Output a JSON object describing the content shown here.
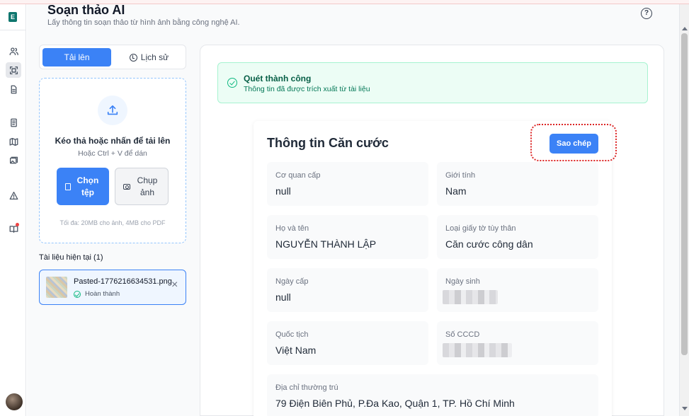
{
  "header": {
    "title": "Soạn thảo AI",
    "subtitle": "Lấy thông tin soạn thảo từ hình ảnh bằng công nghệ AI."
  },
  "sidebar_icons": [
    "users-icon",
    "scan-icon",
    "document-icon",
    "file-text-icon",
    "map-icon",
    "images-icon",
    "warning-icon",
    "book-icon"
  ],
  "tabs": [
    {
      "label": "Tải lên",
      "active": true
    },
    {
      "label": "Lịch sử",
      "active": false
    }
  ],
  "upload": {
    "title": "Kéo thả hoặc nhấn để tải lên",
    "hint": "Hoặc Ctrl + V để dán",
    "choose_label": "Chọn tệp",
    "capture_label": "Chụp ảnh",
    "limit": "Tối đa: 20MB cho ảnh, 4MB cho PDF"
  },
  "current_docs": {
    "label": "Tài liệu hiện tại (1)",
    "files": [
      {
        "name": "Pasted-1776216634531.png",
        "status": "Hoàn thành"
      }
    ]
  },
  "alert": {
    "title": "Quét thành công",
    "message": "Thông tin đã được trích xuất từ tài liệu"
  },
  "result": {
    "title": "Thông tin Căn cước",
    "copy_label": "Sao chép",
    "fields": {
      "issuer": {
        "label": "Cơ quan cấp",
        "value": "null"
      },
      "gender": {
        "label": "Giới tính",
        "value": "Nam"
      },
      "fullname": {
        "label": "Họ và tên",
        "value": "NGUYỄN THÀNH LẬP"
      },
      "doc_type": {
        "label": "Loại giấy tờ tùy thân",
        "value": "Căn cước công dân"
      },
      "issue_date": {
        "label": "Ngày cấp",
        "value": "null"
      },
      "dob": {
        "label": "Ngày sinh",
        "value": ""
      },
      "nationality": {
        "label": "Quốc tịch",
        "value": "Việt Nam"
      },
      "id_number": {
        "label": "Số CCCD",
        "value": ""
      },
      "address": {
        "label": "Địa chỉ thường trú",
        "value": "79 Điện Biên Phủ, P.Đa Kao, Quận 1, TP. Hồ Chí Minh"
      }
    }
  },
  "colors": {
    "accent": "#3b82f6",
    "success": "#10b981",
    "highlight": "#dc2626"
  }
}
